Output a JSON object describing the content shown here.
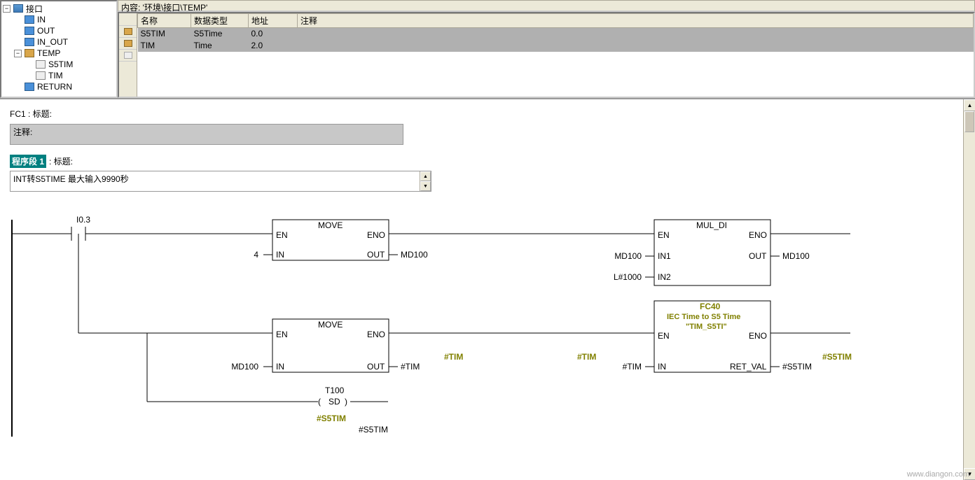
{
  "breadcrumb": "内容:  '环境\\接口\\TEMP'",
  "tree": {
    "root": "接口",
    "items": [
      "IN",
      "OUT",
      "IN_OUT",
      "TEMP",
      "S5TIM",
      "TIM",
      "RETURN"
    ]
  },
  "table": {
    "headers": {
      "name": "名称",
      "type": "数据类型",
      "addr": "地址",
      "comment": "注释"
    },
    "rows": [
      {
        "name": "S5TIM",
        "type": "S5Time",
        "addr": "0.0"
      },
      {
        "name": "TIM",
        "type": "Time",
        "addr": "2.0"
      }
    ]
  },
  "fc": {
    "title": "FC1 : 标题:",
    "comment_label": "注释:",
    "segment_label": "程序段 1",
    "segment_title": ": 标题:",
    "segment_comment": "INT转S5TIME 最大输入9990秒"
  },
  "ladder": {
    "contact": "I0.3",
    "block1": {
      "name": "MOVE",
      "en": "EN",
      "eno": "ENO",
      "in": "IN",
      "out": "OUT",
      "in_val": "4",
      "out_val": "MD100"
    },
    "block2": {
      "name": "MUL_DI",
      "en": "EN",
      "eno": "ENO",
      "in1": "IN1",
      "in2": "IN2",
      "out": "OUT",
      "in1_val": "MD100",
      "in2_val": "L#1000",
      "out_val": "MD100"
    },
    "block3": {
      "name": "MOVE",
      "en": "EN",
      "eno": "ENO",
      "in": "IN",
      "out": "OUT",
      "in_val": "MD100",
      "out_val": "#TIM"
    },
    "sym1": "#TIM",
    "sym2": "#TIM",
    "block4": {
      "fc": "FC40",
      "desc": "IEC Time to S5 Time",
      "inst": "\"TIM_S5TI\"",
      "en": "EN",
      "eno": "ENO",
      "in": "IN",
      "ret": "RET_VAL",
      "in_val": "#TIM",
      "out_val": "#S5TIM"
    },
    "sym3": "#S5TIM",
    "timer": {
      "name": "T100",
      "type": "SD",
      "sym": "#S5TIM",
      "val": "#S5TIM"
    }
  },
  "watermark": "www.diangon.com"
}
